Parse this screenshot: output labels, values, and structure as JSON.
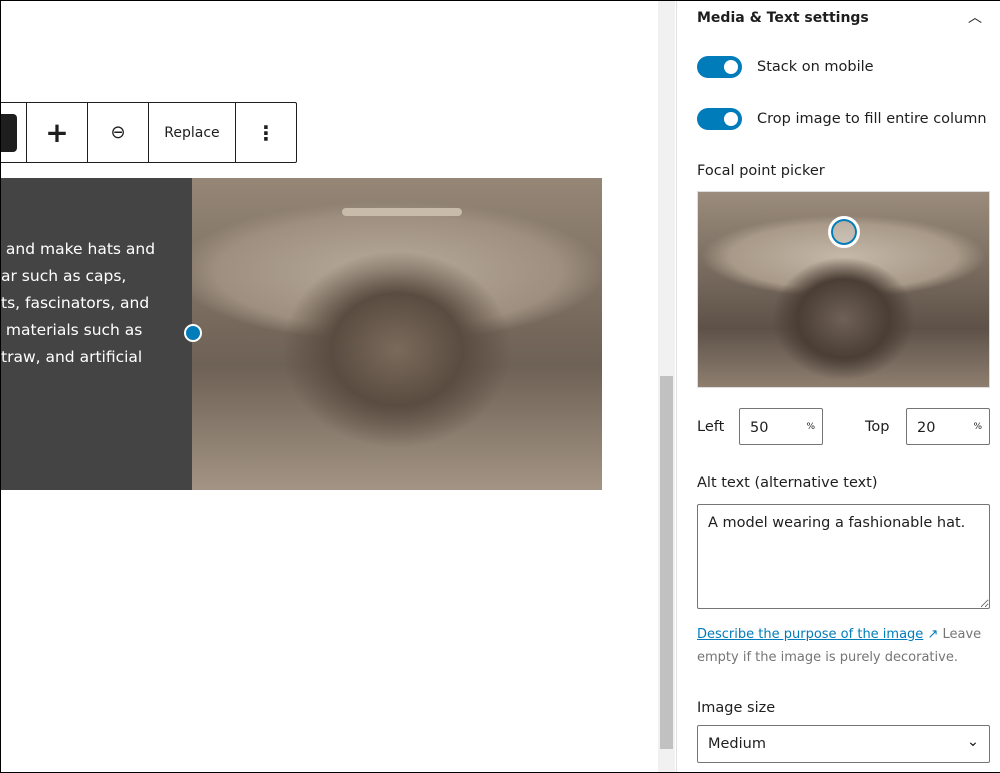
{
  "toolbar": {
    "replace_label": "Replace"
  },
  "media": {
    "text_lines": [
      " and make hats and",
      "ar such as caps,",
      "ts, fascinators, and",
      " materials such as",
      "traw, and artificial"
    ]
  },
  "sidebar": {
    "panel_title": "Media & Text settings",
    "stack_on_mobile": {
      "label": "Stack on mobile",
      "checked": true
    },
    "crop_image": {
      "label": "Crop image to fill entire column",
      "checked": true
    },
    "focal_point": {
      "label": "Focal point picker",
      "left_label": "Left",
      "left_value": "50",
      "top_label": "Top",
      "top_value": "20",
      "unit": "%"
    },
    "alt_text": {
      "label": "Alt text (alternative text)",
      "value": "A model wearing a fashionable hat."
    },
    "help": {
      "link": "Describe the purpose of the image",
      "text": " Leave empty if the image is purely decorative."
    },
    "image_size": {
      "label": "Image size",
      "value": "Medium"
    }
  },
  "colors": {
    "accent": "#007cba",
    "text_bg": "#444444"
  }
}
